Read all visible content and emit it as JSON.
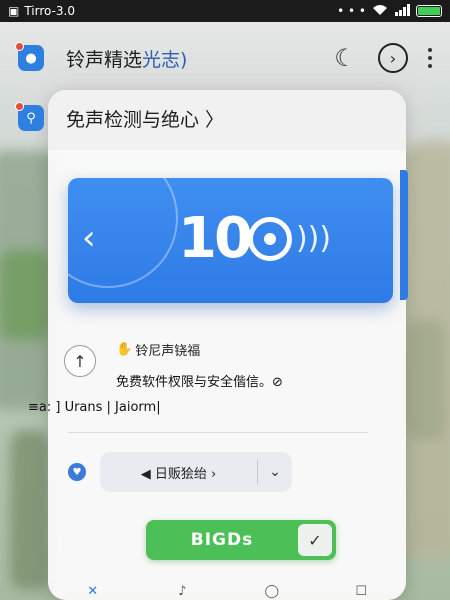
{
  "status_bar": {
    "time": "Tirro-3.0",
    "signal_dots": "• • •"
  },
  "row1": {
    "title_main": "铃声精选",
    "title_accent": "光志)"
  },
  "row2": {
    "title": "免声检测与绝心 〉"
  },
  "hero": {
    "logo_number": "10"
  },
  "info": {
    "title": "铃尼声铙福",
    "description": "免费软件杈限与安全偕信。⊘",
    "meta": "≡a: ]  Urans  |  Jaiorm|"
  },
  "dropdown": {
    "label": "◀ 日贩狯绐 ›"
  },
  "go_button": {
    "label": "BIGDs"
  },
  "icons": {
    "moon": "moon-icon",
    "next": "chevron-right-circle-icon",
    "menu": "kebab-menu-icon",
    "check": "checkmark-icon"
  },
  "colors": {
    "accent_blue": "#2f7be6",
    "green": "#4cbf57",
    "status_bar": "#1b1b1b"
  }
}
